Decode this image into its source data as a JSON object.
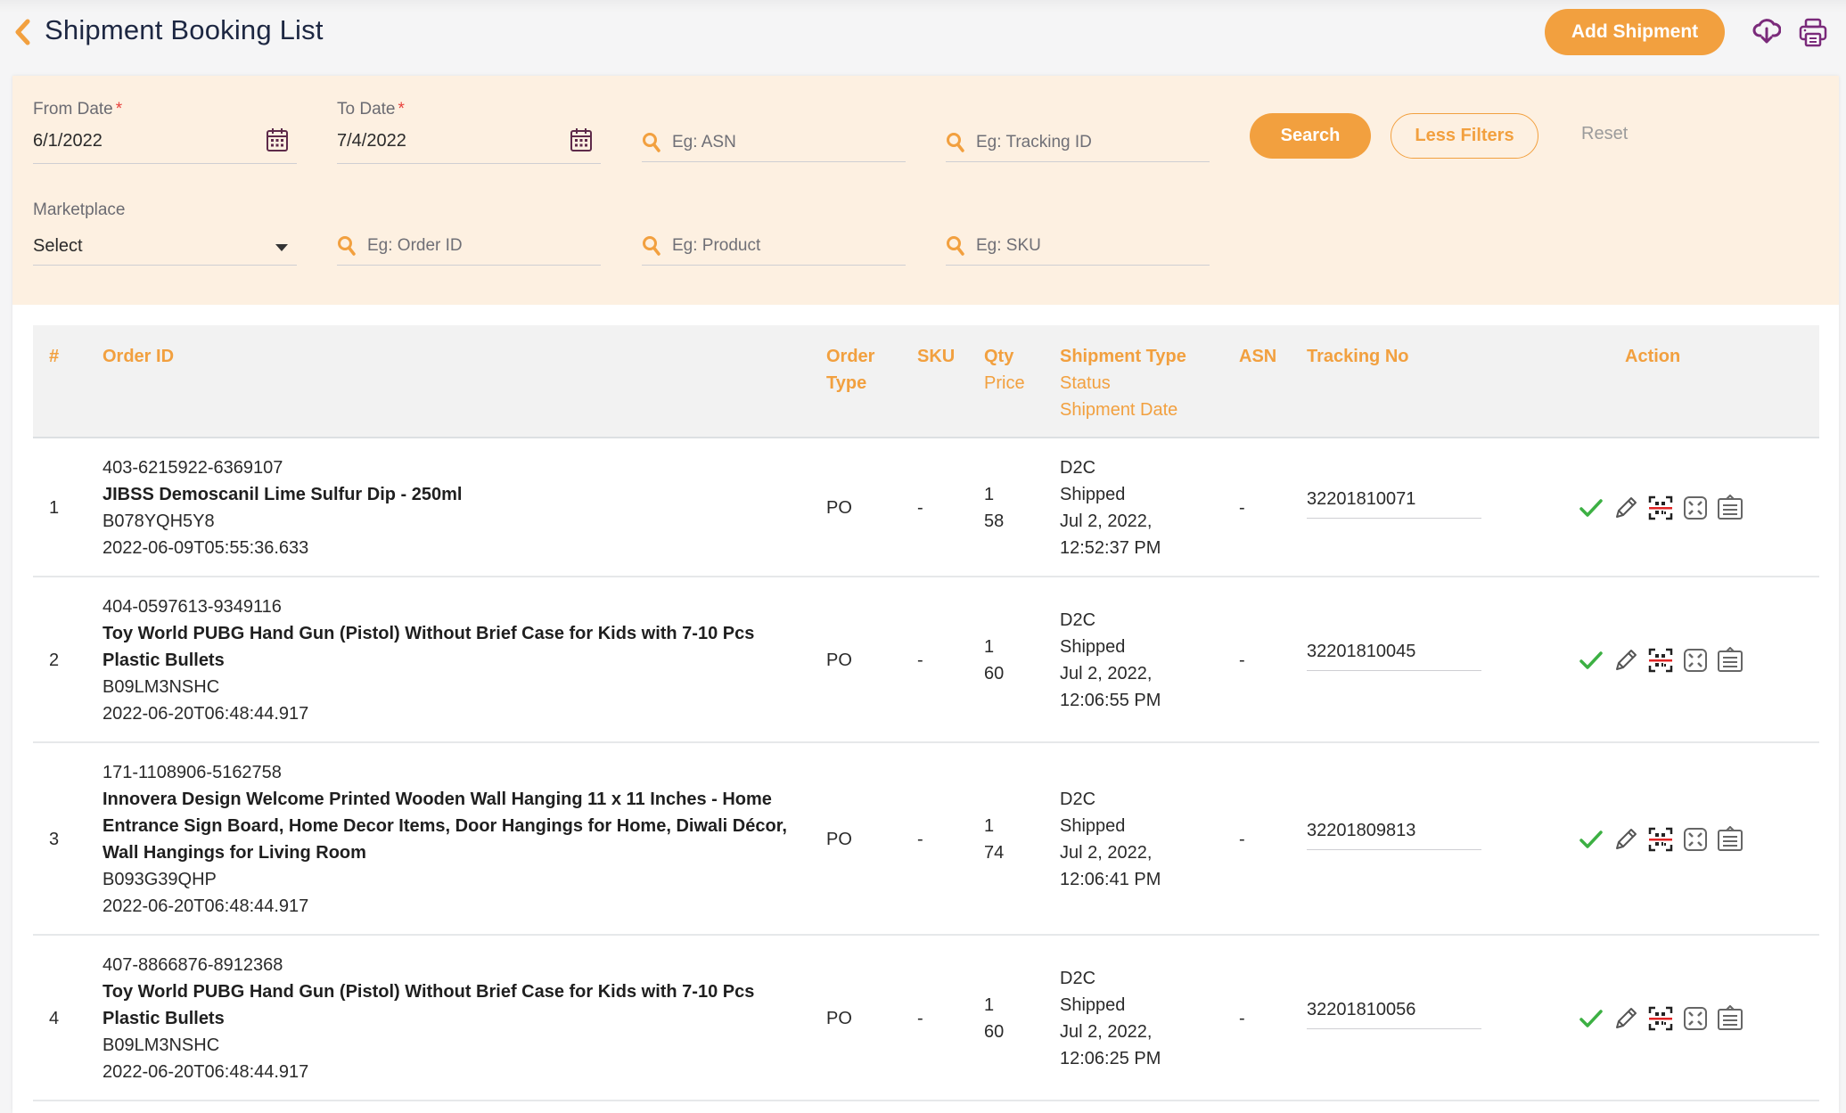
{
  "header": {
    "title": "Shipment Booking List",
    "add_button": "Add Shipment",
    "back_icon": "chevron-left-icon",
    "download_icon": "cloud-download-icon",
    "print_icon": "printer-icon"
  },
  "filters": {
    "from_date": {
      "label": "From Date",
      "required": "*",
      "value": "6/1/2022"
    },
    "to_date": {
      "label": "To Date",
      "required": "*",
      "value": "7/4/2022"
    },
    "asn_placeholder": "Eg: ASN",
    "tracking_placeholder": "Eg: Tracking ID",
    "marketplace": {
      "label": "Marketplace",
      "value": "Select"
    },
    "order_id_placeholder": "Eg: Order ID",
    "product_placeholder": "Eg: Product",
    "sku_placeholder": "Eg: SKU",
    "search_button": "Search",
    "less_filters_button": "Less Filters",
    "reset_button": "Reset"
  },
  "table": {
    "columns": {
      "index": "#",
      "order_id": "Order ID",
      "order_type_1": "Order",
      "order_type_2": "Type",
      "sku": "SKU",
      "qty": "Qty",
      "price": "Price",
      "shipment_type": "Shipment Type",
      "status": "Status",
      "shipment_date": "Shipment Date",
      "asn": "ASN",
      "tracking_no": "Tracking No",
      "action": "Action"
    },
    "rows": [
      {
        "index": "1",
        "order_id": "403-6215922-6369107",
        "product_lines": [
          "JIBSS Demoscanil Lime Sulfur Dip - 250ml"
        ],
        "asin": "B078YQH5Y8",
        "order_date": "2022-06-09T05:55:36.633",
        "order_type": "PO",
        "sku": "-",
        "qty": "1",
        "price": "58",
        "shipment_type": "D2C",
        "status": "Shipped",
        "shipment_date_1": "Jul 2, 2022,",
        "shipment_date_2": "12:52:37 PM",
        "asn": "-",
        "tracking_no": "32201810071"
      },
      {
        "index": "2",
        "order_id": "404-0597613-9349116",
        "product_lines": [
          "Toy World PUBG Hand Gun (Pistol) Without Brief Case for Kids with 7-10 Pcs",
          "Plastic Bullets"
        ],
        "asin": "B09LM3NSHC",
        "order_date": "2022-06-20T06:48:44.917",
        "order_type": "PO",
        "sku": "-",
        "qty": "1",
        "price": "60",
        "shipment_type": "D2C",
        "status": "Shipped",
        "shipment_date_1": "Jul 2, 2022,",
        "shipment_date_2": "12:06:55 PM",
        "asn": "-",
        "tracking_no": "32201810045"
      },
      {
        "index": "3",
        "order_id": "171-1108906-5162758",
        "product_lines": [
          "Innovera Design Welcome Printed Wooden Wall Hanging 11 x 11 Inches - Home",
          "Entrance Sign Board, Home Decor Items, Door Hangings for Home, Diwali Décor,",
          "Wall Hangings for Living Room"
        ],
        "asin": "B093G39QHP",
        "order_date": "2022-06-20T06:48:44.917",
        "order_type": "PO",
        "sku": "-",
        "qty": "1",
        "price": "74",
        "shipment_type": "D2C",
        "status": "Shipped",
        "shipment_date_1": "Jul 2, 2022,",
        "shipment_date_2": "12:06:41 PM",
        "asn": "-",
        "tracking_no": "32201809813"
      },
      {
        "index": "4",
        "order_id": "407-8866876-8912368",
        "product_lines": [
          "Toy World PUBG Hand Gun (Pistol) Without Brief Case for Kids with 7-10 Pcs",
          "Plastic Bullets"
        ],
        "asin": "B09LM3NSHC",
        "order_date": "2022-06-20T06:48:44.917",
        "order_type": "PO",
        "sku": "-",
        "qty": "1",
        "price": "60",
        "shipment_type": "D2C",
        "status": "Shipped",
        "shipment_date_1": "Jul 2, 2022,",
        "shipment_date_2": "12:06:25 PM",
        "asn": "-",
        "tracking_no": "32201810056"
      }
    ],
    "action_icons": [
      "check-icon",
      "edit-pencil-icon",
      "barcode-scan-icon",
      "expand-icon",
      "clipboard-list-icon"
    ]
  },
  "colors": {
    "accent": "#f2a03f",
    "title": "#1d2742",
    "filter_bg": "#fdf0e1",
    "icon_purple": "#7a2a7a",
    "check_green": "#3cb043",
    "required_red": "#e8413c"
  }
}
